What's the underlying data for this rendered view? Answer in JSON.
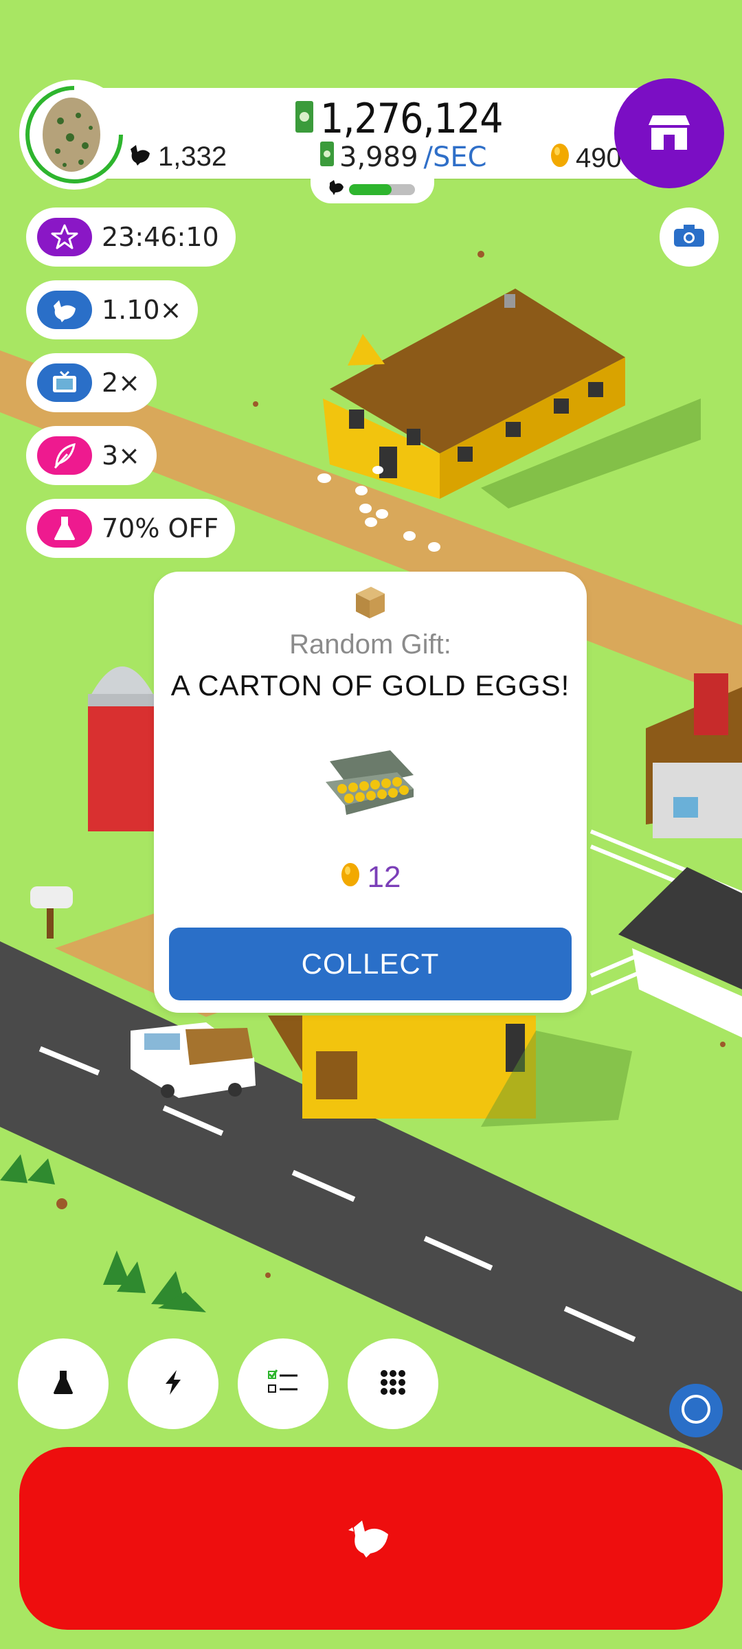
{
  "colors": {
    "grass": "#a8e663",
    "road": "#4a4a4a",
    "dirt": "#d9a85a",
    "accent_purple": "#7b0ec4",
    "collect_blue": "#2a6fc8",
    "hatch_red": "#ee0e0e"
  },
  "hud": {
    "money": "1,276,124",
    "rate_value": "3,989",
    "rate_unit": "/SEC",
    "chickens": "1,332",
    "gold_eggs": "490",
    "progress": 0.65
  },
  "boosts": [
    {
      "icon": "star-icon",
      "label": "23:46:10",
      "color": "#8a17c6"
    },
    {
      "icon": "chicken-icon",
      "label": "1.10×",
      "color": "#2a6fc8"
    },
    {
      "icon": "tv-icon",
      "label": "2×",
      "color": "#2a6fc8"
    },
    {
      "icon": "feather-icon",
      "label": "3×",
      "color": "#ee1a8f"
    },
    {
      "icon": "flask-icon",
      "label": "70% OFF",
      "color": "#ee1a8f"
    }
  ],
  "modal": {
    "title": "Random Gift:",
    "gift_name": "A CARTON OF GOLD EGGS!",
    "reward_amount": "12",
    "collect_label": "COLLECT"
  },
  "bottom_nav": [
    {
      "icon": "flask-icon"
    },
    {
      "icon": "lightning-icon"
    },
    {
      "icon": "checklist-icon"
    },
    {
      "icon": "grid-icon"
    }
  ],
  "hatch_button_icon": "chicken-icon"
}
